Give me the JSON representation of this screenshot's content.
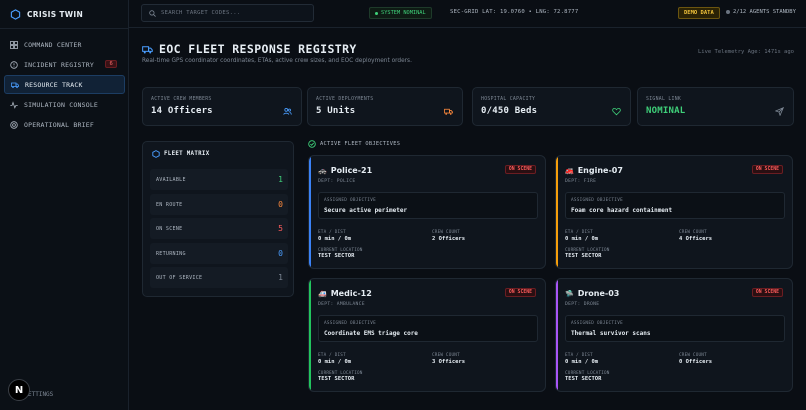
{
  "app": {
    "name": "CRISIS TWIN"
  },
  "nav": [
    {
      "label": "COMMAND CENTER",
      "icon": "grid-icon"
    },
    {
      "label": "INCIDENT REGISTRY",
      "icon": "alert-icon",
      "badge": "6"
    },
    {
      "label": "RESOURCE TRACK",
      "icon": "truck-icon",
      "active": true
    },
    {
      "label": "SIMULATION CONSOLE",
      "icon": "pulse-icon"
    },
    {
      "label": "OPERATIONAL BRIEF",
      "icon": "target-icon"
    }
  ],
  "avatar": {
    "letter": "N"
  },
  "settings_label": "ETTINGS",
  "topbar": {
    "search_placeholder": "SEARCH TARGET CODES...",
    "system_status": "SYSTEM NOMINAL",
    "grid": "SEC-GRID LAT: 19.0760 • LNG: 72.8777",
    "demo": "DEMO DATA",
    "agents": "2/12 AGENTS STANDBY"
  },
  "header": {
    "title": "EOC FLEET RESPONSE REGISTRY",
    "subtitle": "Real-time GPS coordinator coordinates, ETAs, active crew sizes, and EOC deployment orders.",
    "telemetry": "Live Telemetry Age: 1471s ago"
  },
  "stats": [
    {
      "label": "ACTIVE CREW MEMBERS",
      "value": "14 Officers",
      "icon": "users-icon"
    },
    {
      "label": "ACTIVE DEPLOYMENTS",
      "value": "5 Units",
      "icon": "truck-icon"
    },
    {
      "label": "HOSPITAL CAPACITY",
      "value": "0/450 Beds",
      "icon": "heart-icon"
    },
    {
      "label": "SIGNAL LINK",
      "value": "NOMINAL",
      "icon": "send-icon"
    }
  ],
  "matrix": {
    "title": "FLEET MATRIX",
    "rows": [
      {
        "label": "AVAILABLE",
        "value": "1",
        "color": "#3fd17a"
      },
      {
        "label": "EN ROUTE",
        "value": "0",
        "color": "#ff8a3d"
      },
      {
        "label": "ON SCENE",
        "value": "5",
        "color": "#ff5c5c"
      },
      {
        "label": "RETURNING",
        "value": "0",
        "color": "#4a9eff"
      },
      {
        "label": "OUT OF SERVICE",
        "value": "1",
        "color": "#7d8794"
      }
    ]
  },
  "objectives_title": "ACTIVE FLEET OBJECTIVES",
  "units": [
    {
      "emoji": "🚓",
      "name": "Police-21",
      "dept": "DEPT: POLICE",
      "status": "ON SCENE",
      "accent": "#3b82f6",
      "objective_label": "ASSIGNED OBJECTIVE",
      "objective": "Secure active perimeter",
      "eta_label": "ETA / DIST",
      "eta": "0 min / 0m",
      "crew_label": "CREW COUNT",
      "crew": "2 Officers",
      "loc_label": "CURRENT LOCATION",
      "loc": "TEST SECTOR"
    },
    {
      "emoji": "🚒",
      "name": "Engine-07",
      "dept": "DEPT: FIRE",
      "status": "ON SCENE",
      "accent": "#f59e0b",
      "objective_label": "ASSIGNED OBJECTIVE",
      "objective": "Foam core hazard containment",
      "eta_label": "ETA / DIST",
      "eta": "0 min / 0m",
      "crew_label": "CREW COUNT",
      "crew": "4 Officers",
      "loc_label": "CURRENT LOCATION",
      "loc": "TEST SECTOR"
    },
    {
      "emoji": "🚑",
      "name": "Medic-12",
      "dept": "DEPT: AMBULANCE",
      "status": "ON SCENE",
      "accent": "#22c55e",
      "objective_label": "ASSIGNED OBJECTIVE",
      "objective": "Coordinate EMS triage core",
      "eta_label": "ETA / DIST",
      "eta": "0 min / 0m",
      "crew_label": "CREW COUNT",
      "crew": "3 Officers",
      "loc_label": "CURRENT LOCATION",
      "loc": "TEST SECTOR"
    },
    {
      "emoji": "🛸",
      "name": "Drone-03",
      "dept": "DEPT: DRONE",
      "status": "ON SCENE",
      "accent": "#a855f7",
      "objective_label": "ASSIGNED OBJECTIVE",
      "objective": "Thermal survivor scans",
      "eta_label": "ETA / DIST",
      "eta": "0 min / 0m",
      "crew_label": "CREW COUNT",
      "crew": "0 Officers",
      "loc_label": "CURRENT LOCATION",
      "loc": "TEST SECTOR"
    }
  ]
}
